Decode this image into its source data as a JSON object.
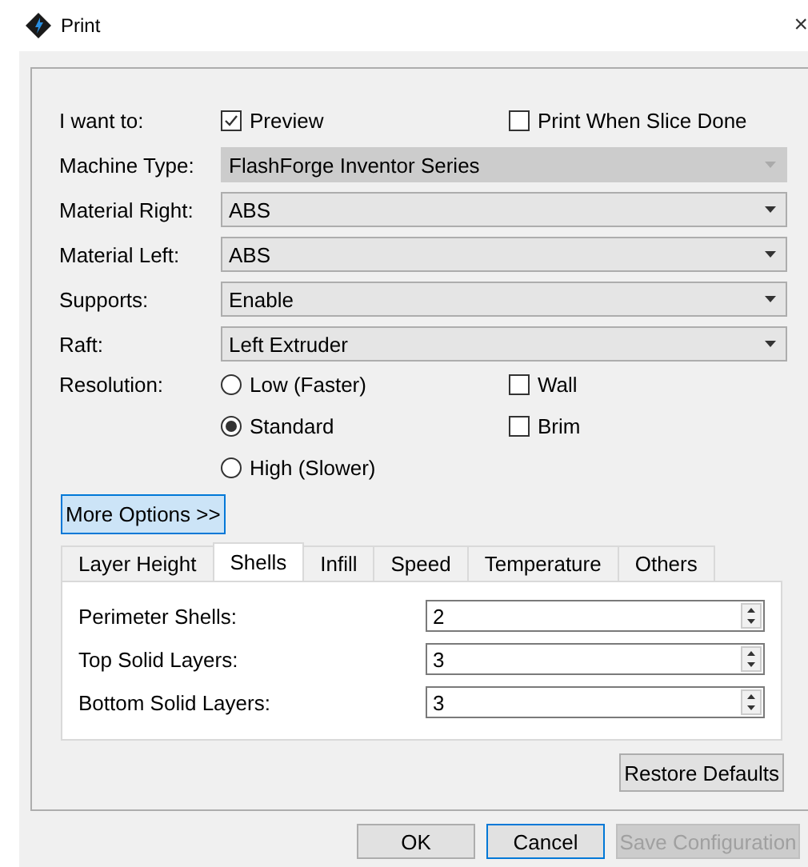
{
  "window": {
    "title": "Print",
    "close": "×"
  },
  "want": {
    "label": "I want to:",
    "options": [
      {
        "label": "Preview",
        "checked": true
      },
      {
        "label": "Print When Slice Done",
        "checked": false
      }
    ]
  },
  "combos": [
    {
      "label": "Machine Type:",
      "value": "FlashForge Inventor Series",
      "disabled": true
    },
    {
      "label": "Material Right:",
      "value": "ABS",
      "disabled": false
    },
    {
      "label": "Material Left:",
      "value": "ABS",
      "disabled": false
    },
    {
      "label": "Supports:",
      "value": "Enable",
      "disabled": false
    },
    {
      "label": "Raft:",
      "value": "Left Extruder",
      "disabled": false
    }
  ],
  "resolution": {
    "label": "Resolution:",
    "radios": [
      {
        "label": "Low (Faster)",
        "selected": false
      },
      {
        "label": "Standard",
        "selected": true
      },
      {
        "label": "High (Slower)",
        "selected": false
      }
    ],
    "extras": [
      {
        "label": "Wall",
        "checked": false
      },
      {
        "label": "Brim",
        "checked": false
      }
    ]
  },
  "more_options": "More Options >>",
  "tabs": [
    {
      "label": "Layer Height",
      "selected": false
    },
    {
      "label": "Shells",
      "selected": true
    },
    {
      "label": "Infill",
      "selected": false
    },
    {
      "label": "Speed",
      "selected": false
    },
    {
      "label": "Temperature",
      "selected": false
    },
    {
      "label": "Others",
      "selected": false
    }
  ],
  "fields": [
    {
      "label": "Perimeter Shells:",
      "value": "2"
    },
    {
      "label": "Top Solid Layers:",
      "value": "3"
    },
    {
      "label": "Bottom Solid Layers:",
      "value": "3"
    }
  ],
  "restore": "Restore Defaults",
  "buttons": [
    {
      "label": "OK",
      "default": false,
      "disabled": false
    },
    {
      "label": "Cancel",
      "default": true,
      "disabled": false
    },
    {
      "label": "Save Configuration",
      "default": false,
      "disabled": true
    }
  ]
}
